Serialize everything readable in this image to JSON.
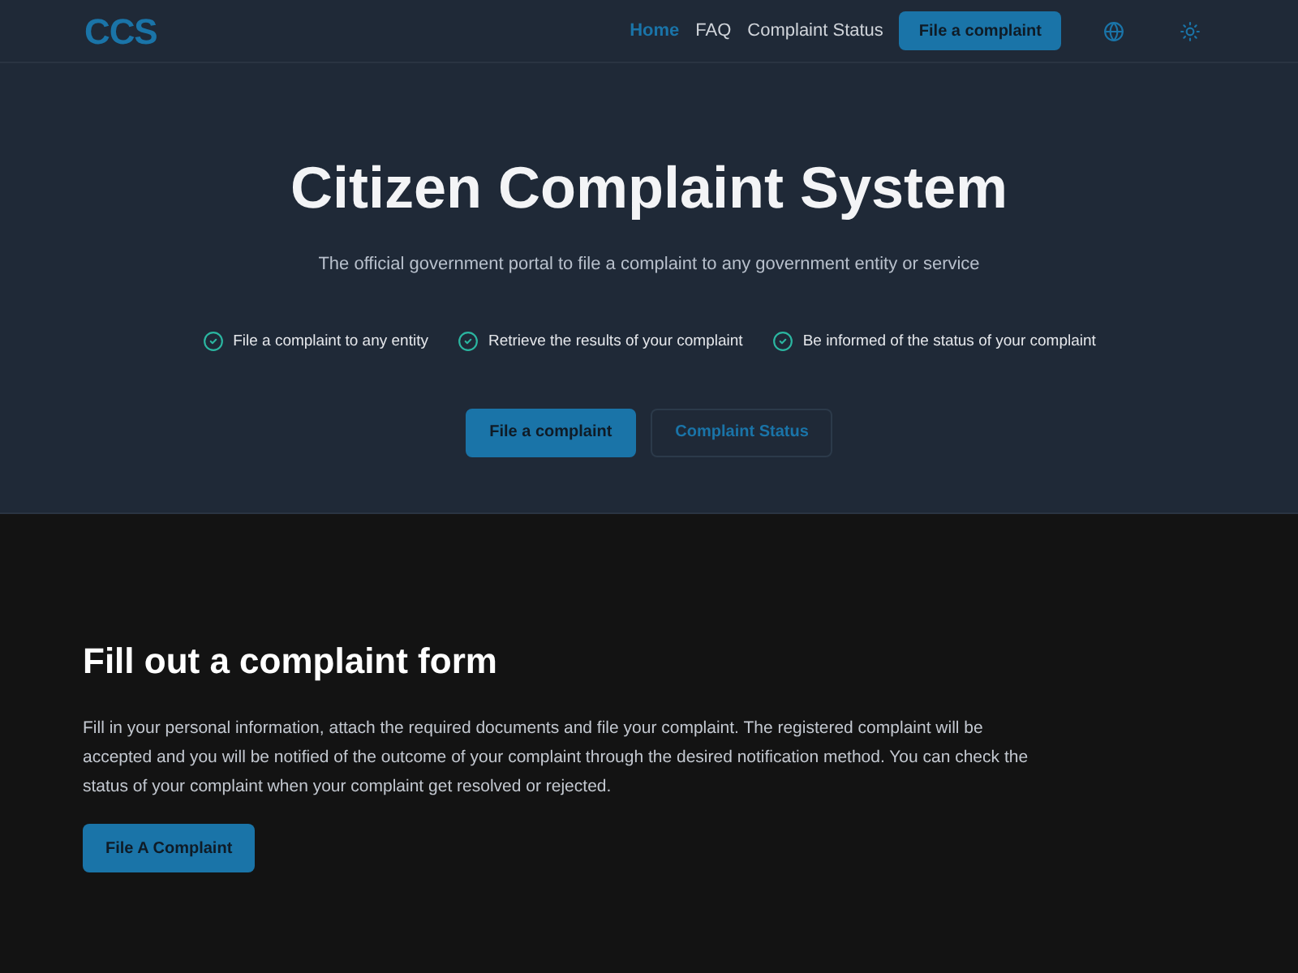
{
  "header": {
    "logo": "CCS",
    "nav": [
      {
        "label": "Home",
        "selected": true
      },
      {
        "label": "FAQ",
        "selected": false
      },
      {
        "label": "Complaint Status",
        "selected": false
      }
    ],
    "cta": "File a complaint"
  },
  "hero": {
    "title": "Citizen Complaint System",
    "subtitle": "The official government portal to file a complaint to any government entity or service",
    "features": [
      "File a complaint to any entity",
      "Retrieve the results of your complaint",
      "Be informed of the status of your complaint"
    ],
    "buttons": [
      {
        "label": "File a complaint",
        "kind": "primary"
      },
      {
        "label": "Complaint Status",
        "kind": "outline"
      }
    ]
  },
  "form_section": {
    "title": "Fill out a complaint form",
    "text": "Fill in your personal information, attach the required documents and file your complaint. The registered complaint will be accepted and you will be notified of the outcome of your complaint through the desired notification method. You can check the status of your complaint when your complaint get resolved or rejected.",
    "button": "File A Complaint"
  }
}
